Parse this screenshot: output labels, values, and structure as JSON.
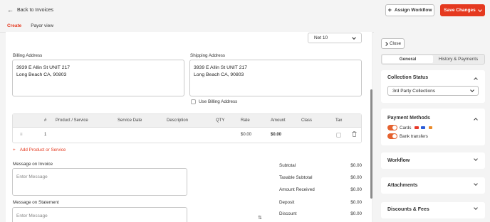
{
  "header": {
    "back_label": "Back to Invoices",
    "assign_workflow_label": "Assign Workflow",
    "save_changes_label": "Save Changes"
  },
  "tabs": [
    {
      "label": "Create",
      "active": true
    },
    {
      "label": "Payor view",
      "active": false
    }
  ],
  "invoice": {
    "terms": "Net 10",
    "billing_address_label": "Billing Address",
    "billing_address_line1": "3939 E Allin St UNIT 217",
    "billing_address_line2": "Long Beach CA, 90803",
    "shipping_address_label": "Shipping Address",
    "shipping_address_line1": "3939 E Allin St UNIT 217",
    "shipping_address_line2": "Long Beach CA, 90803",
    "use_billing_label": "Use Billing Address",
    "table": {
      "headers": [
        "#",
        "Product / Service",
        "Service Date",
        "Description",
        "QTY",
        "Rate",
        "Amount",
        "Class",
        "Tax"
      ],
      "rows": [
        {
          "num": "1",
          "rate": "$0.00",
          "amount": "$0.00"
        }
      ]
    },
    "add_product_label": "Add Product or Service",
    "message_invoice_label": "Message on Invoice",
    "message_invoice_placeholder": "Enter Message",
    "message_statement_label": "Message on Statement",
    "message_statement_placeholder": "Enter Message",
    "summary": [
      {
        "label": "Subtotal",
        "value": "$0.00"
      },
      {
        "label": "Taxable Subtotal",
        "value": "$0.00"
      },
      {
        "label": "Amount Received",
        "value": "$0.00"
      },
      {
        "label": "Deposit",
        "value": "$0.00"
      },
      {
        "label": "Discount",
        "value": "$0.00"
      }
    ]
  },
  "panel": {
    "close_label": "Close",
    "tabs": [
      {
        "label": "General",
        "active": true
      },
      {
        "label": "History & Payments",
        "active": false
      }
    ],
    "collection_status_title": "Collection Status",
    "collection_status_value": "3rd Party Collections",
    "payment_methods_title": "Payment Methods",
    "cards_label": "Cards",
    "bank_transfers_label": "Bank transfers",
    "workflow_title": "Workflow",
    "attachments_title": "Attachments",
    "discounts_title": "Discounts & Fees"
  },
  "colors": {
    "accent": "#e5391f",
    "toggle_on": "#e5622f"
  },
  "icons": {
    "back": "arrow-left-icon",
    "plus": "plus-icon",
    "trash": "trash-icon",
    "drag": "drag-handle-icon",
    "swap": "swap-vertical-icon"
  }
}
